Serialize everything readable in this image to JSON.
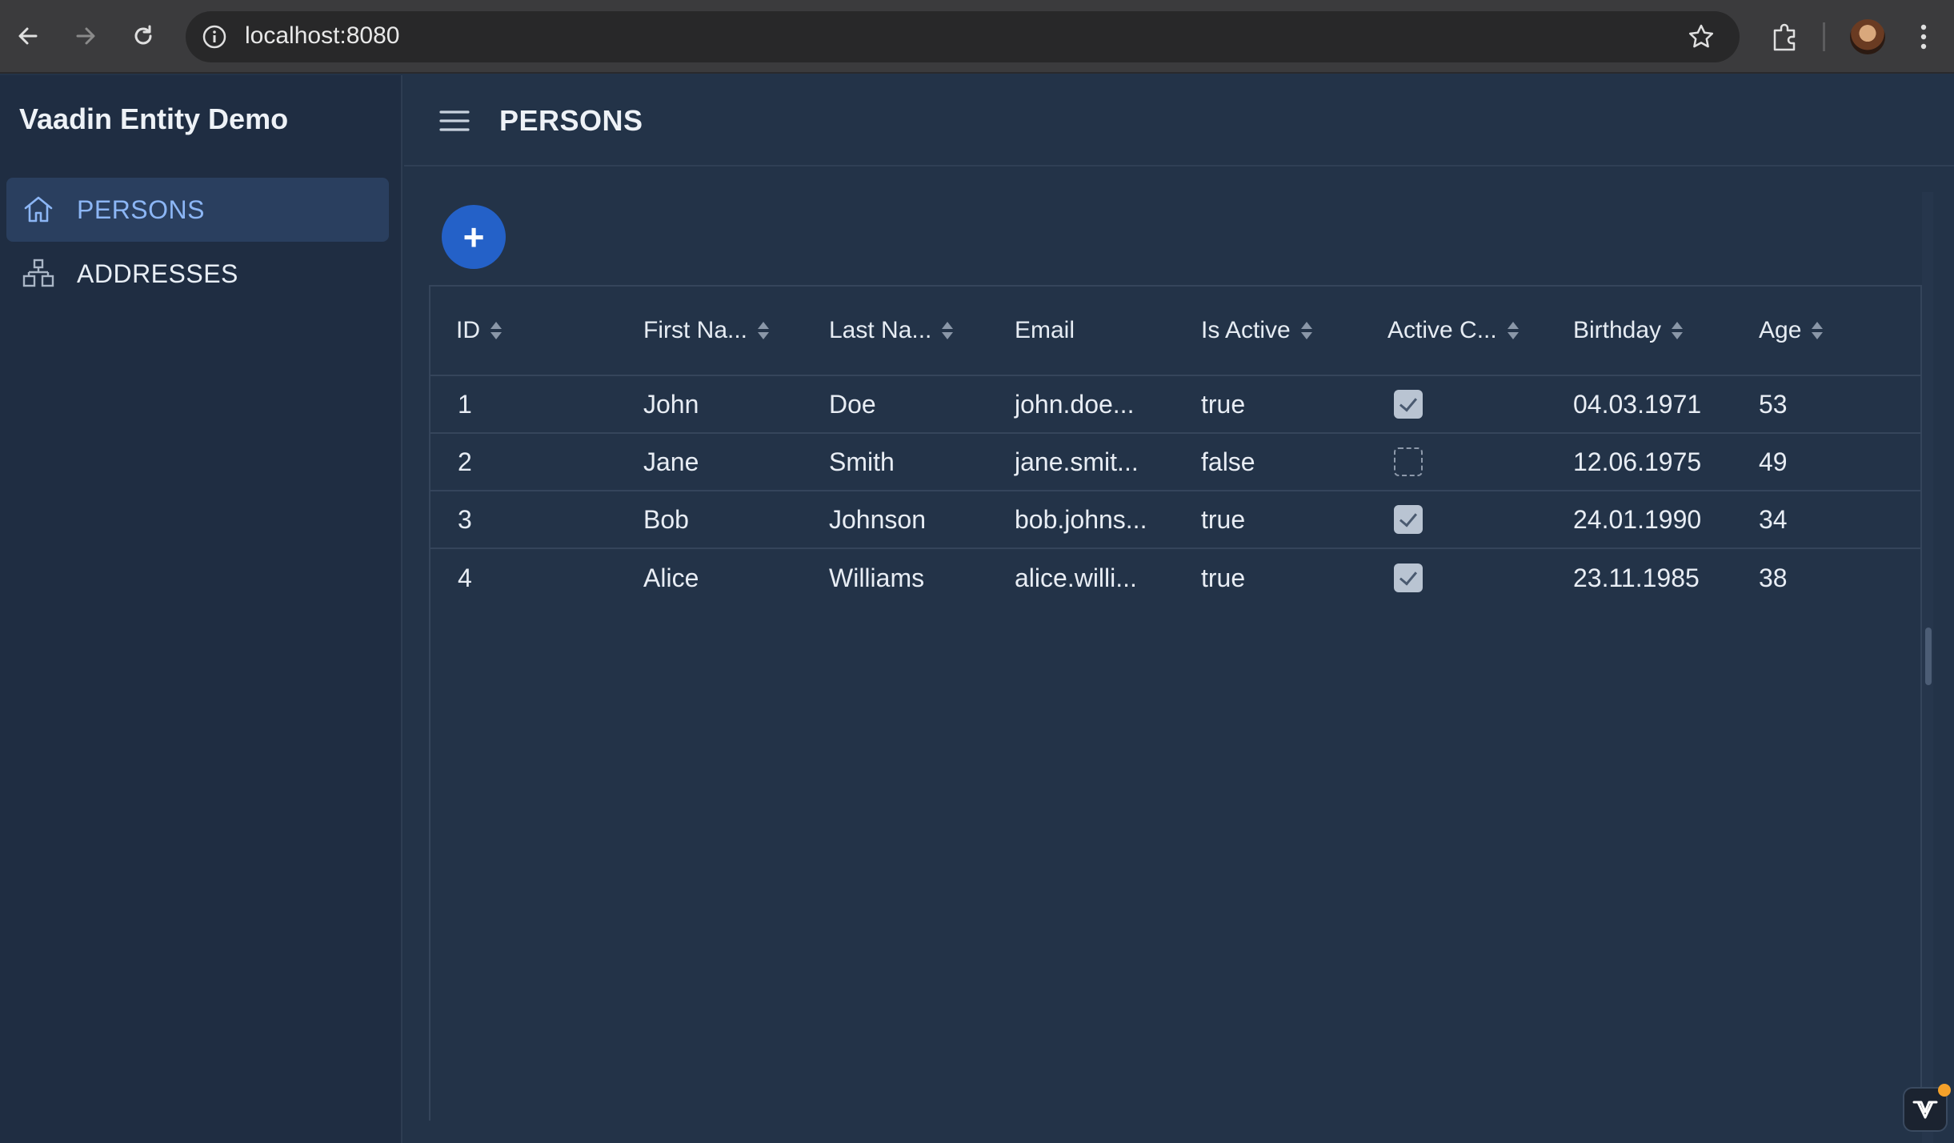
{
  "browser": {
    "url": "localhost:8080",
    "back_icon": "arrow-left-icon",
    "forward_icon": "arrow-right-icon",
    "reload_icon": "reload-icon"
  },
  "drawer": {
    "brand": "Vaadin Entity Demo",
    "items": [
      {
        "label": "PERSONS",
        "icon": "home-icon",
        "active": true
      },
      {
        "label": "ADDRESSES",
        "icon": "sitemap-icon",
        "active": false
      }
    ]
  },
  "header": {
    "title": "PERSONS"
  },
  "fab": {
    "label": "+"
  },
  "grid": {
    "columns": [
      "ID",
      "First Na...",
      "Last Na...",
      "Email",
      "Is Active",
      "Active C...",
      "Birthday",
      "Age"
    ],
    "sortable": [
      true,
      true,
      true,
      false,
      true,
      true,
      true,
      true
    ],
    "rows": [
      {
        "id": "1",
        "first": "John",
        "last": "Doe",
        "email": "john.doe...",
        "active": "true",
        "active_checked": true,
        "birthday": "04.03.1971",
        "age": "53"
      },
      {
        "id": "2",
        "first": "Jane",
        "last": "Smith",
        "email": "jane.smit...",
        "active": "false",
        "active_checked": false,
        "birthday": "12.06.1975",
        "age": "49"
      },
      {
        "id": "3",
        "first": "Bob",
        "last": "Johnson",
        "email": "bob.johns...",
        "active": "true",
        "active_checked": true,
        "birthday": "24.01.1990",
        "age": "34"
      },
      {
        "id": "4",
        "first": "Alice",
        "last": "Williams",
        "email": "alice.willi...",
        "active": "true",
        "active_checked": true,
        "birthday": "23.11.1985",
        "age": "38"
      }
    ]
  },
  "colors": {
    "accent": "#2461c8",
    "active_nav_text": "#8cb6f5",
    "background": "#233348"
  }
}
